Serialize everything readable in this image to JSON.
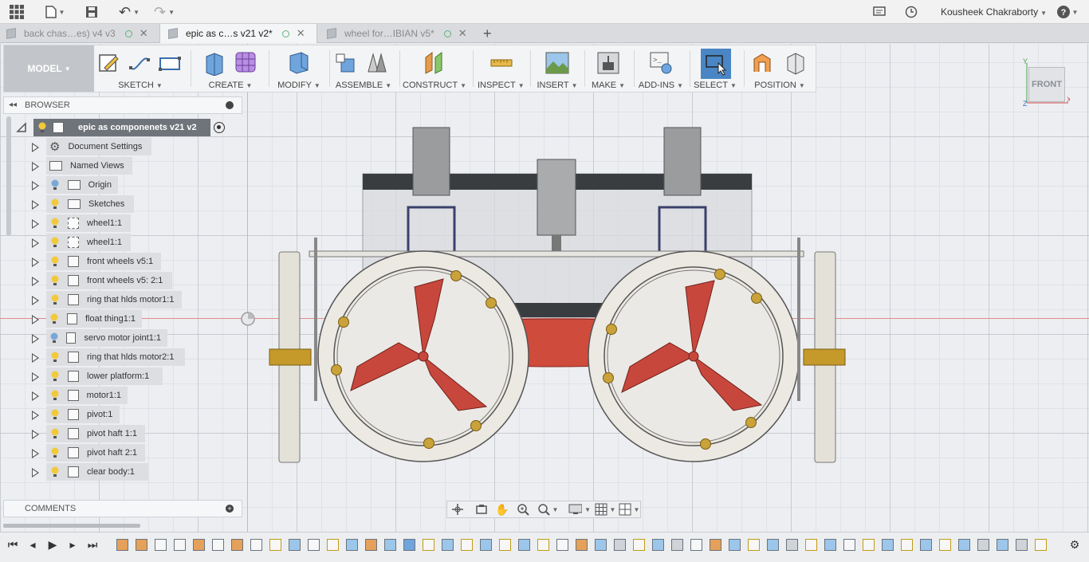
{
  "user": {
    "name": "Kousheek Chakraborty"
  },
  "tabs": [
    {
      "label": "back chas…es) v4 v3",
      "active": false
    },
    {
      "label": "epic as c…s v21 v2*",
      "active": true
    },
    {
      "label": "wheel for…IBIAN v5*",
      "active": false
    }
  ],
  "toolbar": {
    "workspace": "MODEL",
    "groups": [
      {
        "label": "SKETCH"
      },
      {
        "label": "CREATE"
      },
      {
        "label": "MODIFY"
      },
      {
        "label": "ASSEMBLE"
      },
      {
        "label": "CONSTRUCT"
      },
      {
        "label": "INSPECT"
      },
      {
        "label": "INSERT"
      },
      {
        "label": "MAKE"
      },
      {
        "label": "ADD-INS"
      },
      {
        "label": "SELECT"
      },
      {
        "label": "POSITION"
      }
    ]
  },
  "browser": {
    "title": "BROWSER",
    "root": "epic as componenets v21 v2",
    "items": [
      {
        "label": "Document Settings",
        "type": "settings"
      },
      {
        "label": "Named Views",
        "type": "folder"
      },
      {
        "label": "Origin",
        "type": "folder",
        "bulb": "off"
      },
      {
        "label": "Sketches",
        "type": "folder",
        "bulb": "on"
      },
      {
        "label": "wheel1:1",
        "type": "link",
        "bulb": "on"
      },
      {
        "label": "wheel1:1",
        "type": "link",
        "bulb": "on"
      },
      {
        "label": "front wheels v5:1",
        "type": "comp",
        "bulb": "on"
      },
      {
        "label": "front wheels v5: 2:1",
        "type": "comp",
        "bulb": "on"
      },
      {
        "label": "ring that hlds motor1:1",
        "type": "comp",
        "bulb": "on"
      },
      {
        "label": "float thing1:1",
        "type": "comp",
        "bulb": "on"
      },
      {
        "label": "servo motor joint1:1",
        "type": "comp",
        "bulb": "off"
      },
      {
        "label": "ring that hlds motor2:1",
        "type": "comp",
        "bulb": "on"
      },
      {
        "label": "lower platform:1",
        "type": "comp",
        "bulb": "on"
      },
      {
        "label": "motor1:1",
        "type": "comp",
        "bulb": "on"
      },
      {
        "label": "pivot:1",
        "type": "comp",
        "bulb": "on"
      },
      {
        "label": "pivot haft 1:1",
        "type": "comp",
        "bulb": "on"
      },
      {
        "label": "pivot haft 2:1",
        "type": "comp",
        "bulb": "on"
      },
      {
        "label": "clear body:1",
        "type": "comp",
        "bulb": "on"
      }
    ]
  },
  "comments": {
    "title": "COMMENTS"
  },
  "viewcube": {
    "face": "FRONT",
    "axis_y": "Y",
    "axis_z": "Z",
    "axis_x": "X"
  },
  "colors": {
    "accent": "#4a86c5",
    "bulb_on": "#f2c93a",
    "bulb_off": "#7aa7d6",
    "fin": "#c8473c",
    "float": "#d9503f",
    "wood": "#c59a2b"
  }
}
